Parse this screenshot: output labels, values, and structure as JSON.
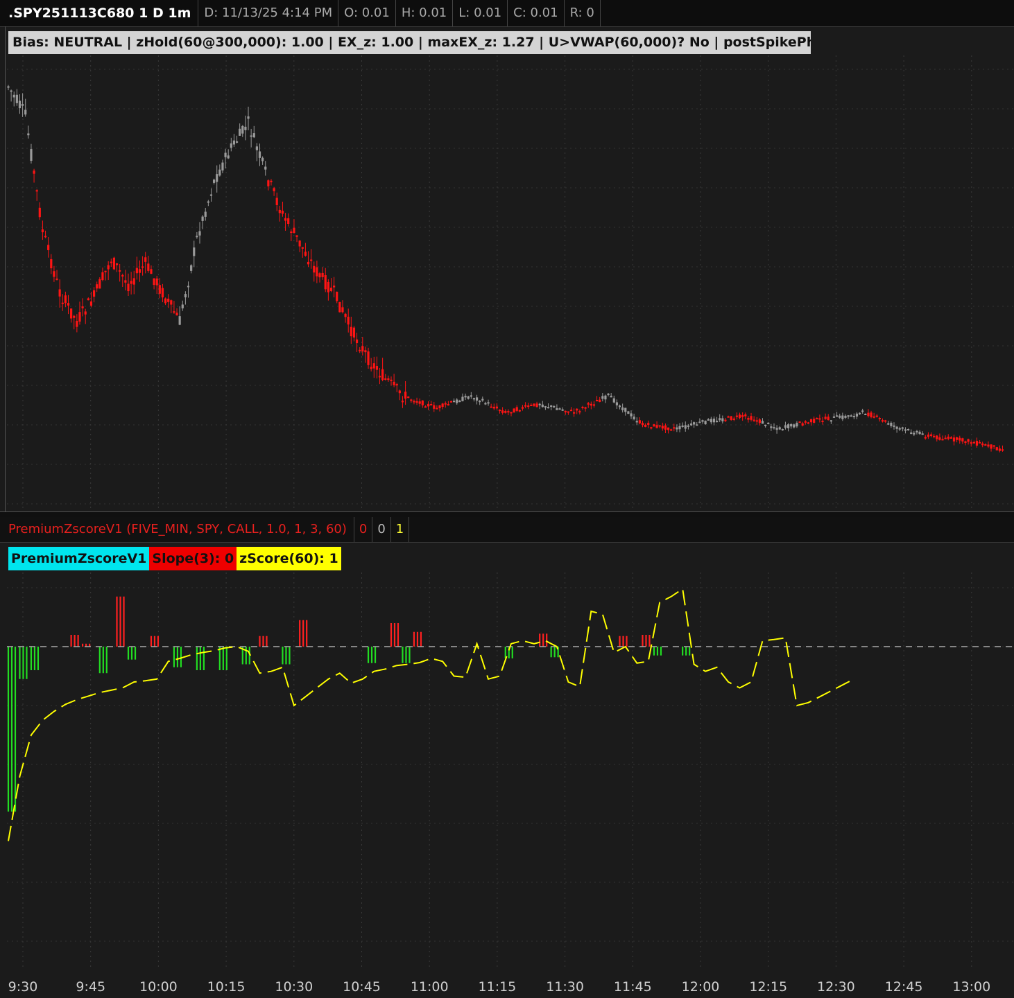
{
  "header": {
    "symbol": ".SPY251113C680 1 D 1m",
    "date": "D: 11/13/25 4:14 PM",
    "open": "O: 0.01",
    "high": "H: 0.01",
    "low": "L: 0.01",
    "close": "C: 0.01",
    "range": "R: 0"
  },
  "bias_label": "Bias: NEUTRAL | zHold(60@300,000): 1.00 | EX_z: 1.00 | maxEX_z: 1.27 | U>VWAP(60,000)? No | postSpikePhase: O",
  "study": {
    "title": "PremiumZscoreV1 (FIVE_MIN, SPY, CALL, 1.0, 1, 3, 60)",
    "values": [
      "0",
      "0",
      "1"
    ]
  },
  "legend": {
    "name": "PremiumZscoreV1",
    "slope": "Slope(3): 0",
    "zscore": "zScore(60): 1"
  },
  "colors": {
    "down": "#ff1414",
    "neutral": "#9a9a9a",
    "zscore": "#ffff00",
    "slope_pos": "#ff2020",
    "slope_neg": "#22dd22",
    "legend_name_bg": "#00e5ee",
    "legend_slope_bg": "#ee0000",
    "legend_z_bg": "#ffff00"
  },
  "chart_data": [
    {
      "type": "line",
      "title": "",
      "price_path_shape": [
        [
          0,
          0.05
        ],
        [
          3,
          0.12
        ],
        [
          6,
          0.4
        ],
        [
          9,
          0.55
        ],
        [
          12,
          0.62
        ],
        [
          15,
          0.56
        ],
        [
          18,
          0.47
        ],
        [
          21,
          0.53
        ],
        [
          24,
          0.48
        ],
        [
          27,
          0.55
        ],
        [
          30,
          0.62
        ],
        [
          33,
          0.42
        ],
        [
          36,
          0.28
        ],
        [
          39,
          0.2
        ],
        [
          42,
          0.14
        ],
        [
          45,
          0.26
        ],
        [
          48,
          0.36
        ],
        [
          51,
          0.43
        ],
        [
          54,
          0.5
        ],
        [
          57,
          0.55
        ],
        [
          60,
          0.64
        ],
        [
          63,
          0.71
        ],
        [
          66,
          0.76
        ],
        [
          69,
          0.8
        ],
        [
          75,
          0.83
        ],
        [
          81,
          0.8
        ],
        [
          87,
          0.84
        ],
        [
          93,
          0.82
        ],
        [
          99,
          0.84
        ],
        [
          105,
          0.8
        ],
        [
          111,
          0.87
        ],
        [
          117,
          0.88
        ],
        [
          123,
          0.86
        ],
        [
          129,
          0.85
        ],
        [
          135,
          0.88
        ],
        [
          141,
          0.86
        ],
        [
          147,
          0.85
        ],
        [
          150,
          0.84
        ],
        [
          156,
          0.88
        ],
        [
          162,
          0.9
        ],
        [
          168,
          0.91
        ],
        [
          174,
          0.93
        ]
      ],
      "neutral_bar_ranges": [
        [
          0,
          4
        ],
        [
          30,
          45
        ],
        [
          78,
          84
        ],
        [
          93,
          97
        ],
        [
          104,
          110
        ],
        [
          117,
          125
        ],
        [
          132,
          138
        ],
        [
          144,
          150
        ],
        [
          154,
          160
        ]
      ],
      "x_ticks": [
        "9:30",
        "9:45",
        "10:00",
        "10:15",
        "10:30",
        "10:45",
        "11:00",
        "11:15",
        "11:30",
        "11:45",
        "12:00",
        "12:15",
        "12:30",
        "12:45",
        "13:00"
      ]
    },
    {
      "type": "line",
      "series": [
        {
          "name": "zScore(60)",
          "values": [
            [
              0,
              -3.3
            ],
            [
              2,
              -2.2
            ],
            [
              4,
              -1.5
            ],
            [
              6,
              -1.25
            ],
            [
              8,
              -1.1
            ],
            [
              10,
              -0.98
            ],
            [
              12,
              -0.9
            ],
            [
              14,
              -0.84
            ],
            [
              16,
              -0.78
            ],
            [
              18,
              -0.74
            ],
            [
              20,
              -0.7
            ],
            [
              22,
              -0.6
            ],
            [
              24,
              -0.58
            ],
            [
              26,
              -0.55
            ],
            [
              28,
              -0.25
            ],
            [
              30,
              -0.2
            ],
            [
              32,
              -0.14
            ],
            [
              34,
              -0.1
            ],
            [
              36,
              -0.07
            ],
            [
              38,
              -0.02
            ],
            [
              40,
              0.0
            ],
            [
              42,
              -0.08
            ],
            [
              44,
              -0.45
            ],
            [
              46,
              -0.42
            ],
            [
              48,
              -0.35
            ],
            [
              50,
              -1.0
            ],
            [
              52,
              -0.85
            ],
            [
              54,
              -0.7
            ],
            [
              56,
              -0.55
            ],
            [
              58,
              -0.45
            ],
            [
              60,
              -0.62
            ],
            [
              62,
              -0.55
            ],
            [
              64,
              -0.42
            ],
            [
              66,
              -0.38
            ],
            [
              68,
              -0.32
            ],
            [
              70,
              -0.3
            ],
            [
              72,
              -0.27
            ],
            [
              74,
              -0.2
            ],
            [
              76,
              -0.25
            ],
            [
              78,
              -0.5
            ],
            [
              80,
              -0.52
            ],
            [
              82,
              0.05
            ],
            [
              84,
              -0.55
            ],
            [
              86,
              -0.5
            ],
            [
              88,
              0.05
            ],
            [
              90,
              0.1
            ],
            [
              92,
              0.05
            ],
            [
              94,
              0.1
            ],
            [
              96,
              0.0
            ],
            [
              98,
              -0.6
            ],
            [
              100,
              -0.68
            ],
            [
              102,
              0.6
            ],
            [
              104,
              0.55
            ],
            [
              106,
              -0.1
            ],
            [
              108,
              0.0
            ],
            [
              110,
              -0.28
            ],
            [
              112,
              -0.25
            ],
            [
              114,
              0.75
            ],
            [
              116,
              0.85
            ],
            [
              118,
              0.98
            ],
            [
              120,
              -0.3
            ],
            [
              122,
              -0.42
            ],
            [
              124,
              -0.35
            ],
            [
              126,
              -0.6
            ],
            [
              128,
              -0.7
            ],
            [
              130,
              -0.6
            ],
            [
              132,
              0.1
            ],
            [
              134,
              0.12
            ],
            [
              136,
              0.15
            ],
            [
              138,
              -1.0
            ],
            [
              140,
              -0.95
            ],
            [
              142,
              -0.85
            ],
            [
              144,
              -0.75
            ],
            [
              146,
              -0.65
            ],
            [
              148,
              -0.55
            ]
          ]
        },
        {
          "name": "Slope(3)",
          "values": [
            [
              0,
              -2.8
            ],
            [
              2,
              -0.55
            ],
            [
              4,
              -0.4
            ],
            [
              11,
              0.2
            ],
            [
              13,
              0.05
            ],
            [
              16,
              -0.45
            ],
            [
              19,
              0.85
            ],
            [
              21,
              -0.22
            ],
            [
              25,
              0.18
            ],
            [
              29,
              -0.35
            ],
            [
              33,
              -0.4
            ],
            [
              37,
              -0.4
            ],
            [
              41,
              -0.3
            ],
            [
              44,
              0.18
            ],
            [
              48,
              -0.3
            ],
            [
              51,
              0.45
            ],
            [
              63,
              -0.28
            ],
            [
              67,
              0.4
            ],
            [
              69,
              -0.28
            ],
            [
              71,
              0.25
            ],
            [
              87,
              -0.2
            ],
            [
              93,
              0.22
            ],
            [
              95,
              -0.18
            ],
            [
              107,
              0.18
            ],
            [
              111,
              0.2
            ],
            [
              113,
              -0.15
            ],
            [
              118,
              -0.15
            ]
          ]
        }
      ]
    }
  ]
}
